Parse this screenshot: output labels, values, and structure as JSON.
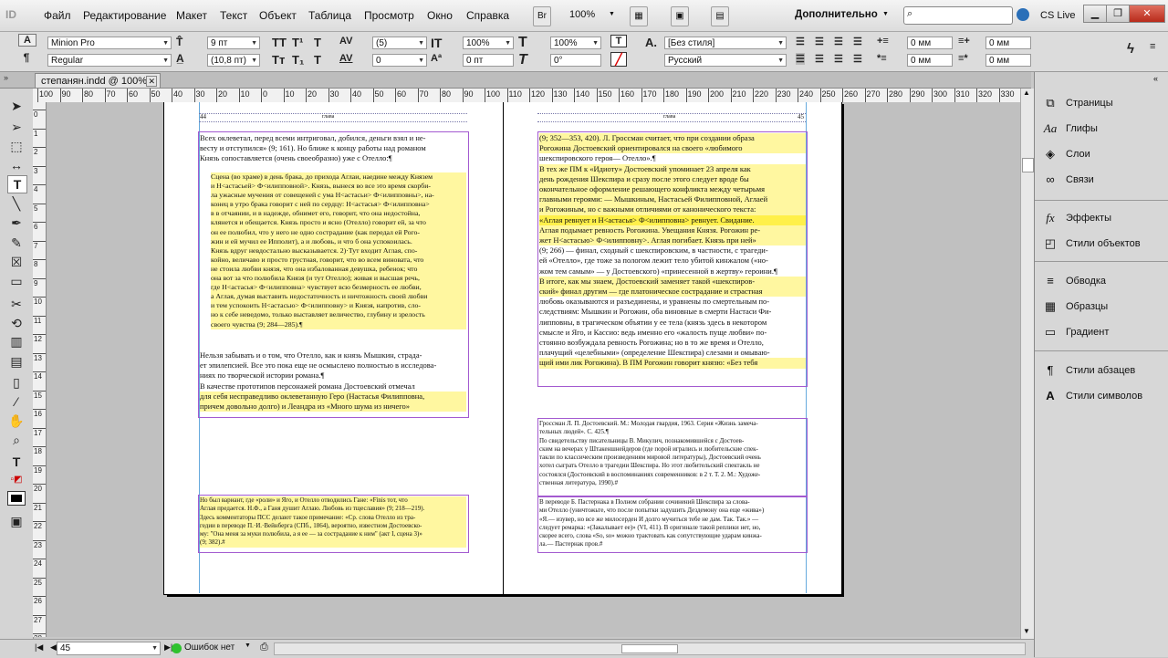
{
  "menubar": {
    "logo": "ID",
    "items": [
      "Файл",
      "Редактирование",
      "Макет",
      "Текст",
      "Объект",
      "Таблица",
      "Просмотр",
      "Окно",
      "Справка"
    ],
    "bridge": "Br",
    "zoom": "100%",
    "workspace": "Дополнительно",
    "cslive": "CS Live",
    "search_placeholder": ""
  },
  "control": {
    "font_family": "Minion Pro",
    "font_style": "Regular",
    "font_size": "9 пт",
    "leading": "(10,8 пт)",
    "kerning": "(5)",
    "tracking": "0",
    "vscale": "100%",
    "hscale": "100%",
    "baseline": "0 пт",
    "skew": "0°",
    "char_style": "[Без стиля]",
    "language": "Русский",
    "indent_left": "0 мм",
    "indent_right": "0 мм",
    "indent_first": "0 мм",
    "indent_last": "0 мм",
    "caps_btns": [
      "TT",
      "T¹",
      "T"
    ],
    "caps_btns2": [
      "Tт",
      "T₁",
      "T"
    ]
  },
  "tab": {
    "title": "степанян.indd @ 100%",
    "close": "✕"
  },
  "ruler": {
    "h_labels": [
      "100",
      "90",
      "80",
      "70",
      "60",
      "50",
      "40",
      "30",
      "20",
      "10",
      "0",
      "10",
      "20",
      "30",
      "40",
      "50",
      "60",
      "70",
      "80",
      "90",
      "100",
      "110",
      "120",
      "130",
      "140",
      "150",
      "160",
      "170",
      "180",
      "190",
      "200",
      "210",
      "220",
      "230",
      "240",
      "250",
      "260",
      "270",
      "280",
      "290",
      "300",
      "310",
      "320",
      "330",
      "34"
    ],
    "v_labels": [
      "0",
      "1",
      "2",
      "3",
      "4",
      "5",
      "6",
      "7",
      "8",
      "9",
      "10",
      "11",
      "12",
      "13",
      "14",
      "15",
      "16",
      "17",
      "18",
      "19",
      "20",
      "21",
      "22",
      "23",
      "24",
      "25",
      "26",
      "27",
      "28"
    ]
  },
  "pages": {
    "left_num": "44",
    "left_header": "глава",
    "right_header": "глава",
    "right_num": "45",
    "left_body": [
      {
        "t": "Всех оклеветал, перед всеми интриговал, добился, деньги взял и не-",
        "h": 0
      },
      {
        "t": "весту и отступился» (9; 161). Но ближе к концу работы над романом",
        "h": 0
      },
      {
        "t": "Князь сопоставляется (очень своеобразно) уже с Отелло:¶",
        "h": 0
      }
    ],
    "left_quote": [
      "Сцена (во храме) в день брака, до прихода Аглаи, наедине между Князем",
      "и Н<астасьей> Ф<илипповной>. Князь, вынеся во все это время скорби-",
      "ла ужасные мучения от совещеней с ума Н<астасьи> Ф<илипповны>, на-",
      "конец в утро брака говорит с ней по сердцу: Н<астасья> Ф<илипповна>",
      "в в отчаянии, и в надежде, обнимет его, говорит, что она недостойна,",
      "клянется и обещается. Князь просто и ясно (Отелло) говорит ей, за что",
      "он ее полюбил, что у него не одно сострадание (как передал ей Рого-",
      "жин и ей мучил ее Ипполит), а и любовь, и что б она успокоилась.",
      "Князь вдруг невдостально высказывается. 2)·Тут входит Аглая, спо-",
      "койно, величаво и просто грустная, говорит, что во всем виновата, что",
      "не стоила любви князя, что она избалованная девушка, ребенок; что",
      "она вот за что полюбила Князя (и тут Отелло); живая и высшая речь,",
      "где Н<астасья> Ф<илипповна> чувствует всю безмерность ее любви,",
      "а Аглая, думая выставить недостаточность и ничтожность своей любви",
      "и тем успокоить Н<астасью> Ф<илипповну> и Князя, напротив, сло-",
      "но к себе неведомо, только выставляет величество, глубину и зрелость",
      "своего чувства (9; 284—285).¶"
    ],
    "left_body2": [
      {
        "t": "Нельзя забывать и о том, что Отелло, как и князь Мышкин, страда-",
        "h": 0
      },
      {
        "t": "ет эпилепсией. Все это пока еще не осмыслено полностью в исследова-",
        "h": 0
      },
      {
        "t": "ниях по творческой истории романа.¶",
        "h": 0
      },
      {
        "t": "В качестве прототипов персонажей романа Достоевский отмечал",
        "h": 0
      },
      {
        "t": "для себя несправедливо оклеветанную Геро (Настасья Филипповна,",
        "h": 1
      },
      {
        "t": "причем довольно долго) и Леандра из «Много шума из ничего»",
        "h": 1
      }
    ],
    "left_fn": [
      "Но был вариант, где «роли» и Яго, и Отелло отводились Гане: «Finis тот, что",
      "Аглая предается. Н.Ф., а Ганя душит Аглаю. Любовь из тщеславия» (9; 218—219).",
      "Здесь комментаторы ПСС делают такое примечание: «Ср. слова Отелло из тра-",
      "гедии в переводе П.·И.·Вейнберга (СПб., 1864), вероятно, известном Достоевско-",
      "му: \"Она меня за муки полюбила, а я ее — за сострадание к ним\" (акт I, сцена 3)»",
      "(9; 382).#"
    ],
    "right_body": [
      {
        "t": "(9; 352—353, 420). Л. Гроссман считает, что при создании образа",
        "h": 1
      },
      {
        "t": "Рогожина Достоевский ориентировался на своего «любимого",
        "h": 1
      },
      {
        "t": "шекспировского героя— Отелло».¶",
        "h": 0
      },
      {
        "t": "В тех же ПМ к «Идиоту» Достоевский упоминает 23 апреля как",
        "h": 1
      },
      {
        "t": "день рождения Шекспира и сразу после этого следует вроде бы",
        "h": 1
      },
      {
        "t": "окончательное оформление решающего конфликта между четырьмя",
        "h": 1
      },
      {
        "t": "главными героями: — Мышкиным, Настасьей Филипповной, Аглаей",
        "h": 1
      },
      {
        "t": "и Рогожиным, но с важными отличиями от канонического текста:",
        "h": 1
      },
      {
        "t": "«Аглая ревнует и Н<астасья> Ф<илипповна> ревнует. Свидание.",
        "h": 2
      },
      {
        "t": "Аглая подымает ревность Рогожина. Увещания Князя. Рогожин ре-",
        "h": 1
      },
      {
        "t": "жет Н<астасью> Ф<илипповну>. Аглая погибает. Князь при ней»",
        "h": 1
      },
      {
        "t": "(9; 266) — финал, сходный с шекспировским, в частности, с трагеди-",
        "h": 0
      },
      {
        "t": "ей «Отелло», где тоже за пологом лежит тело убитой кинжалом («но-",
        "h": 0
      },
      {
        "t": "жом тем самым» — у Достоевского) «принесенной в жертву» героини.¶",
        "h": 0
      },
      {
        "t": "В итоге, как мы знаем, Достоевский заменяет такой «шекспиров-",
        "h": 1
      },
      {
        "t": "ский» финал другим — где платоническое сострадание и страстная",
        "h": 1
      },
      {
        "t": "любовь оказываются и разъединены, и уравнены по смертельным по-",
        "h": 0
      },
      {
        "t": "следствиям: Мышкин и Рогожин, оба виновные в смерти Настаси Фи-",
        "h": 0
      },
      {
        "t": "липповны, в трагическом объятии у ее тела (князь здесь в некотором",
        "h": 0
      },
      {
        "t": "смысле и Яго, и Кассио: ведь именно его «жалость пуще любви» по-",
        "h": 0
      },
      {
        "t": "стоянно возбуждала ревность Рогожина; но в то же время и Отелло,",
        "h": 0
      },
      {
        "t": "плачущий «целебными» (определение Шекспира) слезами и омываю-",
        "h": 0
      },
      {
        "t": "щий ими лик Рогожина). В ПМ Рогожин говорит князю: «Без тебя",
        "h": 1
      }
    ],
    "right_fn1": [
      "Гроссман Л. П. Достоевский. М.: Молодая гвардия, 1963. Серия «Жизнь замеча-",
      "тельных людей». С. 425.¶",
      "По свидетельству писательницы В. Микулич, познакомившейся с Достоев-",
      "ским на вечерах у Штакеншнейдеров (где порой игрались и любительские спек-",
      "такли по классическим произведениям мировой литературы), Достоевский очень",
      "хотел сыграть Отелло в трагедии Шекспира. Но этот любительский спектакль не",
      "состоялся (Достоевский в воспоминаниях современников: в 2 т. Т. 2. М.: Художе-",
      "ственная литература, 1990).#"
    ],
    "right_fn2": [
      "В переводе Б. Пастернака в Полном собрании сочинений Шекспира за слова-",
      "ми Отелло (уничтожьте, что после попытки задушить Дездемону она еще «жива»)",
      "«Я.— изувер, но все же милосерден И долго мучиться тебе не дам. Так. Так.» —",
      "следует ремарка: «(Закалывает ее)» (VI, 411). В оригинале такой реплики нет, но,",
      "скорее всего, слова «So, so» можно трактовать как сопутствующие ударам кинжа-",
      "ла.— Пастернак пров.#"
    ]
  },
  "panels": {
    "group1": [
      "Страницы",
      "Глифы",
      "Слои",
      "Связи"
    ],
    "group2": [
      "Эффекты",
      "Стили объектов"
    ],
    "group3": [
      "Обводка",
      "Образцы",
      "Градиент"
    ],
    "group4": [
      "Стили абзацев",
      "Стили символов"
    ]
  },
  "status": {
    "page": "45",
    "errors": "Ошибок нет"
  },
  "colors": {
    "highlight": "#fff7a0",
    "highlight_strong": "#fff04a",
    "frame": "#a35ad0",
    "guide": "#66aadd"
  }
}
